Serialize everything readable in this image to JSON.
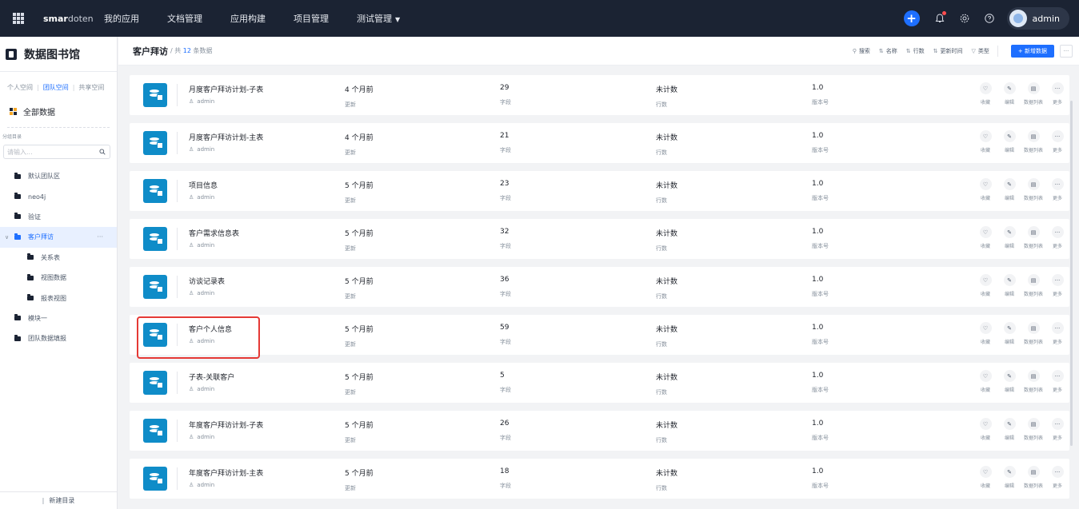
{
  "topbar": {
    "brand_bold": "smar",
    "brand_light": "doten",
    "nav": [
      "我的应用",
      "文档管理",
      "应用构建",
      "项目管理",
      "测试管理"
    ],
    "user": "admin",
    "icons": [
      "apps-grid-icon",
      "plus-icon",
      "bell-icon",
      "settings-icon",
      "help-icon"
    ]
  },
  "sidebar": {
    "title": "数据图书馆",
    "tabs": [
      "个人空间",
      "团队空间",
      "共享空间"
    ],
    "all_data": "全部数据",
    "category_label": "分组目录",
    "search_placeholder": "请输入...",
    "tree": [
      {
        "label": "默认团队区",
        "level": 1
      },
      {
        "label": "neo4j",
        "level": 1
      },
      {
        "label": "验证",
        "level": 1
      },
      {
        "label": "客户拜访",
        "level": 1,
        "active": true,
        "more": "···"
      },
      {
        "label": "关系表",
        "level": 2
      },
      {
        "label": "视图数据",
        "level": 2
      },
      {
        "label": "报表视图",
        "level": 2
      },
      {
        "label": "模块一",
        "level": 1
      },
      {
        "label": "团队数据填报",
        "level": 1
      }
    ],
    "new_dir": "新建目录"
  },
  "main": {
    "title": "客户拜访",
    "count_prefix": "/ 共",
    "count": "12",
    "count_suffix": "条数据",
    "tools": [
      "搜索",
      "名称",
      "行数",
      "更新时间",
      "类型"
    ],
    "add_button": "+ 新增数据",
    "more_button": "···"
  },
  "labels": {
    "updated": "更新",
    "fields": "字段",
    "rows": "行数",
    "version": "版本号",
    "actions": [
      "收藏",
      "编辑",
      "数据列表",
      "更多"
    ]
  },
  "rows": [
    {
      "name": "月度客户拜访计划-子表",
      "owner": "admin",
      "updated": "4 个月前",
      "fields": "29",
      "rows": "未计数",
      "version": "1.0"
    },
    {
      "name": "月度客户拜访计划-主表",
      "owner": "admin",
      "updated": "4 个月前",
      "fields": "21",
      "rows": "未计数",
      "version": "1.0"
    },
    {
      "name": "项目信息",
      "owner": "admin",
      "updated": "5 个月前",
      "fields": "23",
      "rows": "未计数",
      "version": "1.0"
    },
    {
      "name": "客户需求信息表",
      "owner": "admin",
      "updated": "5 个月前",
      "fields": "32",
      "rows": "未计数",
      "version": "1.0"
    },
    {
      "name": "访谈记录表",
      "owner": "admin",
      "updated": "5 个月前",
      "fields": "36",
      "rows": "未计数",
      "version": "1.0"
    },
    {
      "name": "客户个人信息",
      "owner": "admin",
      "updated": "5 个月前",
      "fields": "59",
      "rows": "未计数",
      "version": "1.0"
    },
    {
      "name": "子表-关联客户",
      "owner": "admin",
      "updated": "5 个月前",
      "fields": "5",
      "rows": "未计数",
      "version": "1.0"
    },
    {
      "name": "年度客户拜访计划-子表",
      "owner": "admin",
      "updated": "5 个月前",
      "fields": "26",
      "rows": "未计数",
      "version": "1.0"
    },
    {
      "name": "年度客户拜访计划-主表",
      "owner": "admin",
      "updated": "5 个月前",
      "fields": "18",
      "rows": "未计数",
      "version": "1.0"
    }
  ],
  "colors": {
    "accent": "#1e6fff",
    "topbar": "#1b2333",
    "highlight": "#e53935",
    "row_icon": "#0f8cc8"
  }
}
